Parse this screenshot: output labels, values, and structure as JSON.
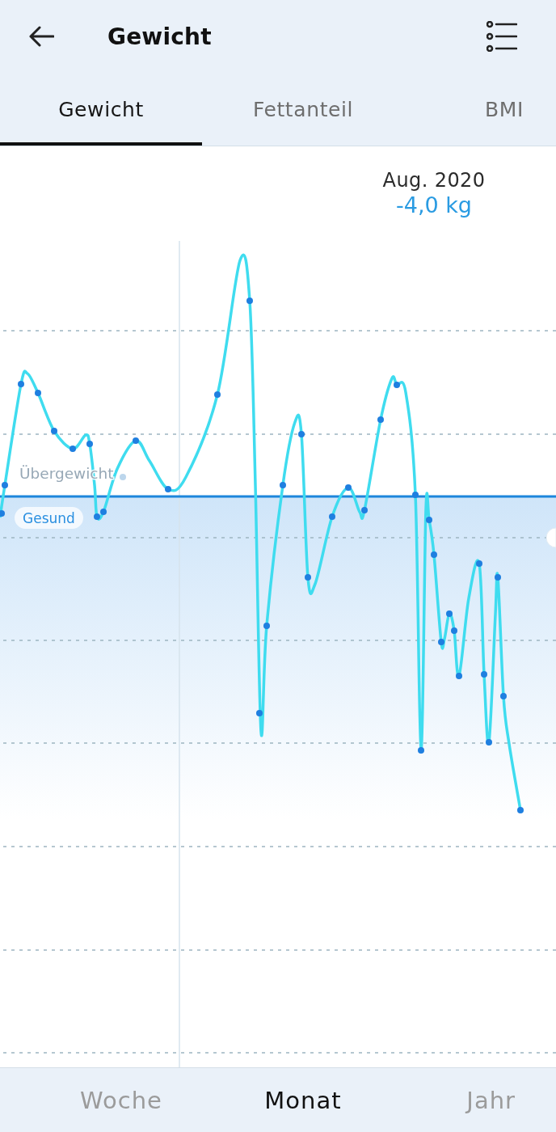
{
  "header": {
    "title": "Gewicht"
  },
  "tabs": [
    {
      "label": "Gewicht",
      "selected": true
    },
    {
      "label": "Fettanteil",
      "selected": false
    },
    {
      "label": "BMI",
      "selected": false
    }
  ],
  "summary": {
    "period": "Aug. 2020",
    "change": "-4,0 kg"
  },
  "chart": {
    "zones": [
      {
        "label": "Übergewicht",
        "kind": "above"
      },
      {
        "label": "Gesund",
        "kind": "below"
      }
    ]
  },
  "periods": [
    {
      "label": "Woche",
      "selected": false
    },
    {
      "label": "Monat",
      "selected": true
    },
    {
      "label": "Jahr",
      "selected": false
    }
  ]
}
